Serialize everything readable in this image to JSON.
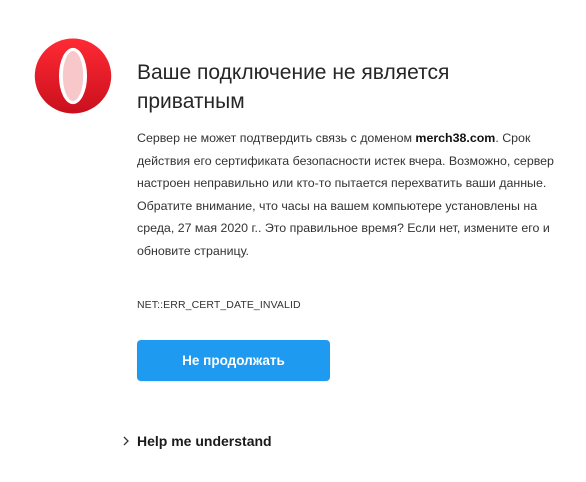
{
  "brand": {
    "logo_icon": "opera-logo-icon",
    "colors": {
      "logo_red": "#e0202b",
      "button_blue": "#1e9af0"
    }
  },
  "page": {
    "title": "Ваше подключение не является приватным",
    "description_before": "Сервер не может подтвердить связь с доменом ",
    "domain": "merch38.com",
    "description_after": ". Срок действия его сертификата безопасности истек вчера. Возможно, сервер настроен неправильно или кто-то пытается перехватить ваши данные. Обратите внимание, что часы на вашем компьютере установлены на среда, 27 мая 2020 г.. Это правильное время? Если нет, измените его и обновите страницу.",
    "error_code": "NET::ERR_CERT_DATE_INVALID"
  },
  "actions": {
    "back_button_label": "Не продолжать",
    "help_link_label": "Help me understand",
    "help_link_icon": "chevron-right-icon"
  }
}
